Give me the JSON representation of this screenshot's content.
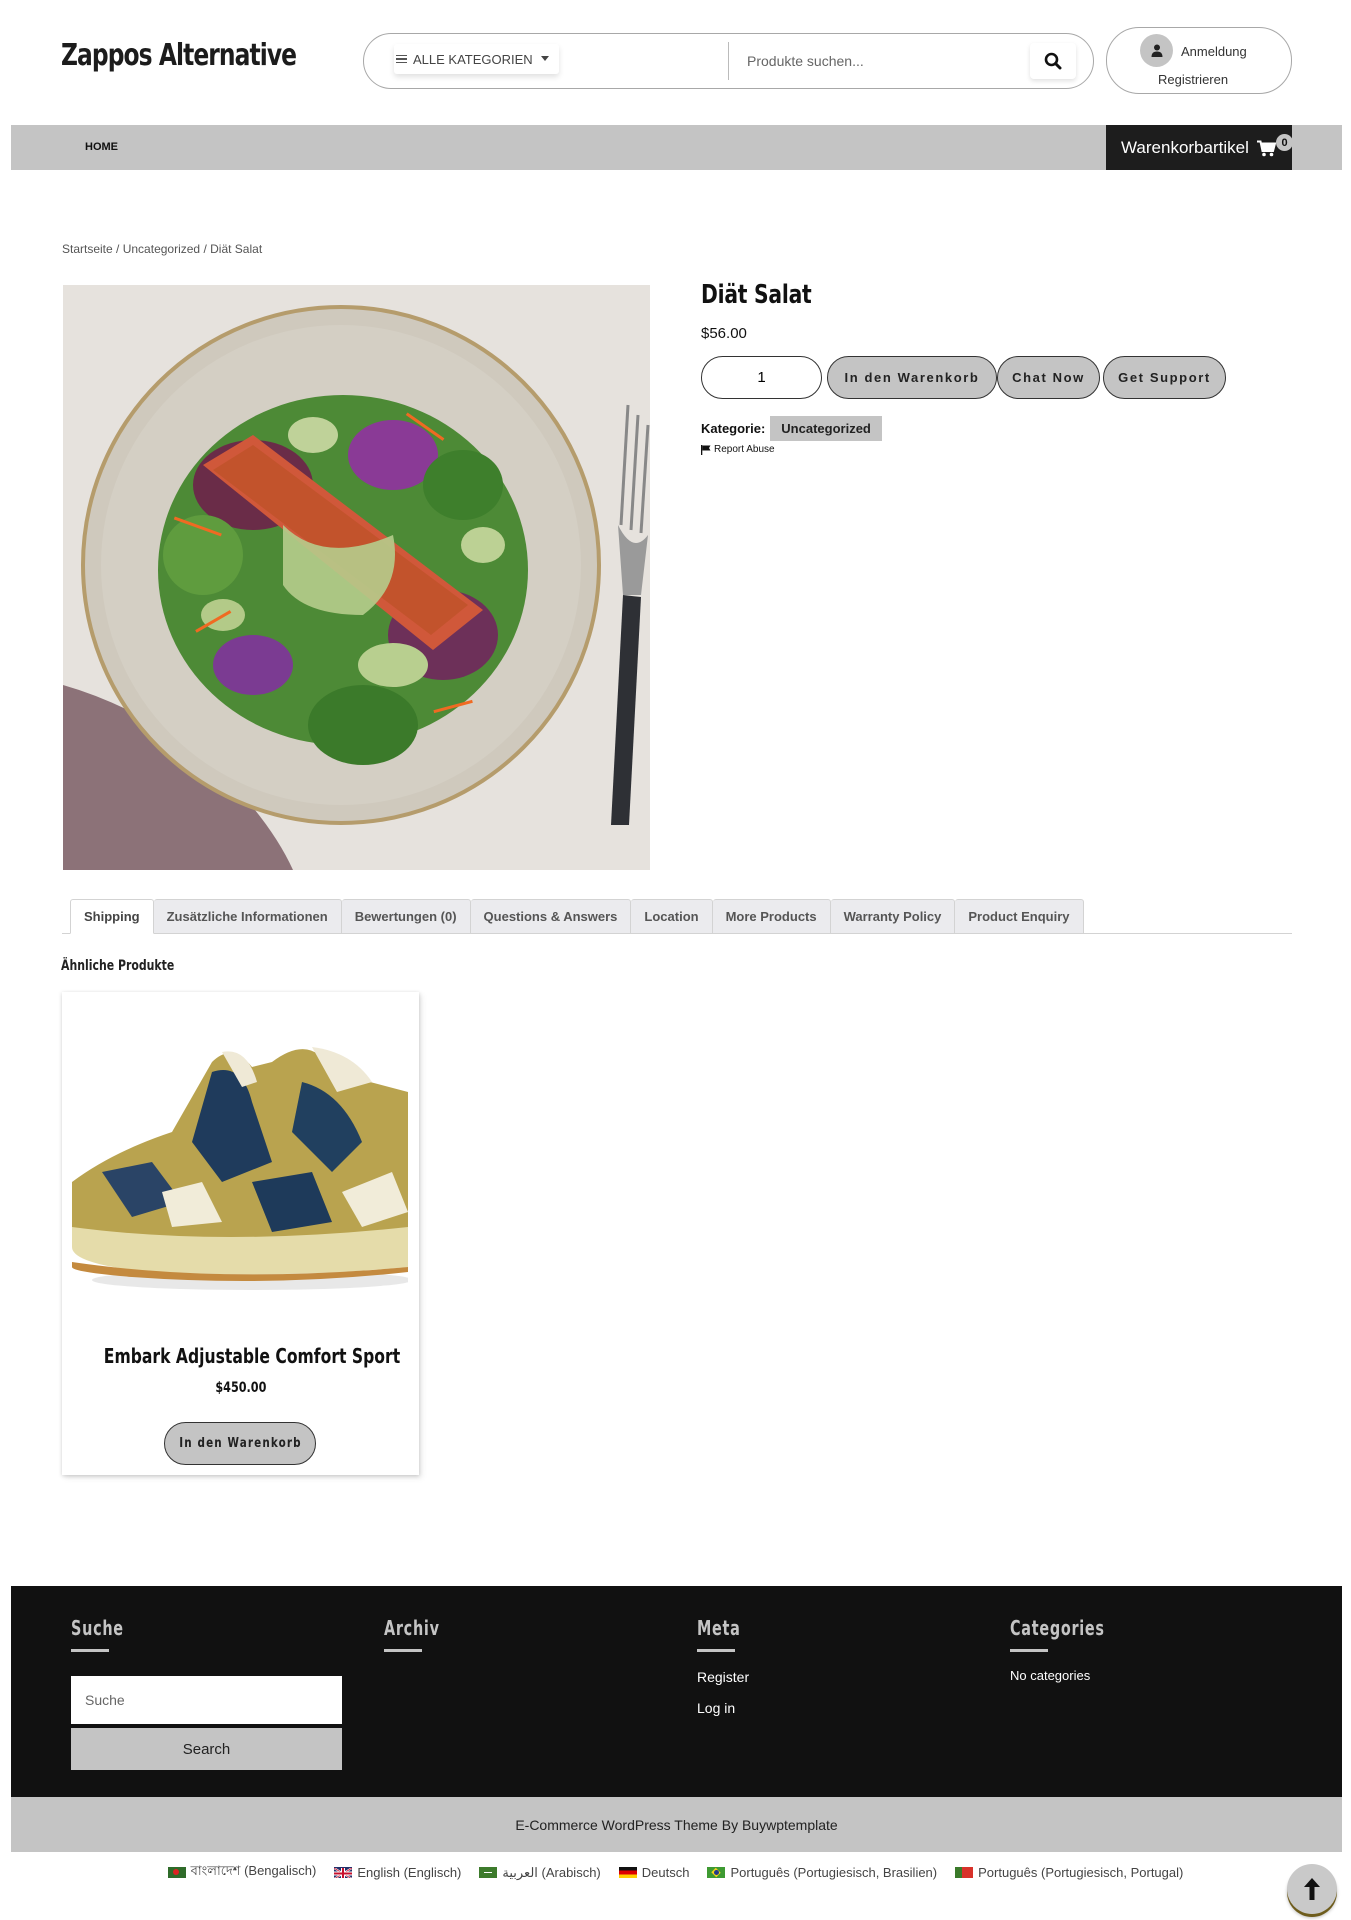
{
  "header": {
    "logo": "Zappos Alternative",
    "category_select": {
      "selected": "ALLE KATEGORIEN",
      "icon": "menu-icon"
    },
    "search": {
      "placeholder": "Produkte suchen...",
      "icon": "search-icon"
    },
    "account": {
      "login": "Anmeldung",
      "register": "Registrieren",
      "icon": "user-icon"
    }
  },
  "nav": {
    "items": [
      {
        "label": "HOME"
      }
    ],
    "cart": {
      "label": "Warenkorbartikel",
      "count": "0",
      "icon": "cart-icon"
    }
  },
  "breadcrumb": {
    "items": [
      "Startseite",
      "Uncategorized",
      "Diät Salat"
    ],
    "separator": " / "
  },
  "product": {
    "title": "Diät Salat",
    "price": "$56.00",
    "quantity": "1",
    "image_alt": "Salmon salad on a plate with fork",
    "buttons": {
      "add_to_cart": "In den Warenkorb",
      "chat": "Chat Now",
      "support": "Get Support"
    },
    "category_label": "Kategorie:",
    "category": "Uncategorized",
    "report": "Report Abuse"
  },
  "tabs": [
    {
      "label": "Shipping",
      "active": true
    },
    {
      "label": "Zusätzliche Informationen",
      "active": false
    },
    {
      "label": "Bewertungen (0)",
      "active": false
    },
    {
      "label": "Questions & Answers",
      "active": false
    },
    {
      "label": "Location",
      "active": false
    },
    {
      "label": "More Products",
      "active": false
    },
    {
      "label": "Warranty Policy",
      "active": false
    },
    {
      "label": "Product Enquiry",
      "active": false
    }
  ],
  "related": {
    "title": "Ähnliche Produkte",
    "products": [
      {
        "name": "Embark Adjustable Comfort Sport",
        "price": "$450.00",
        "button": "In den Warenkorb"
      }
    ]
  },
  "footer": {
    "search": {
      "heading": "Suche",
      "placeholder": "Suche",
      "button": "Search"
    },
    "archive": {
      "heading": "Archiv"
    },
    "meta": {
      "heading": "Meta",
      "links": [
        "Register",
        "Log in"
      ]
    },
    "categories": {
      "heading": "Categories",
      "empty": "No categories"
    },
    "copyright": "E-Commerce WordPress Theme By Buywptemplate"
  },
  "languages": [
    {
      "label": "বাংলাদেশ (Bengalisch)",
      "flag": "bd"
    },
    {
      "label": "English (Englisch)",
      "flag": "gb"
    },
    {
      "label": "العربية (Arabisch)",
      "flag": "sa"
    },
    {
      "label": "Deutsch",
      "flag": "de"
    },
    {
      "label": "Português (Portugiesisch, Brasilien)",
      "flag": "br"
    },
    {
      "label": "Português (Portugiesisch, Portugal)",
      "flag": "pt"
    }
  ],
  "colors": {
    "gray": "#c4c4c4",
    "dark": "#111111",
    "cart_bg": "#1d1d1d"
  },
  "back_to_top": {
    "icon": "arrow-up-icon"
  }
}
